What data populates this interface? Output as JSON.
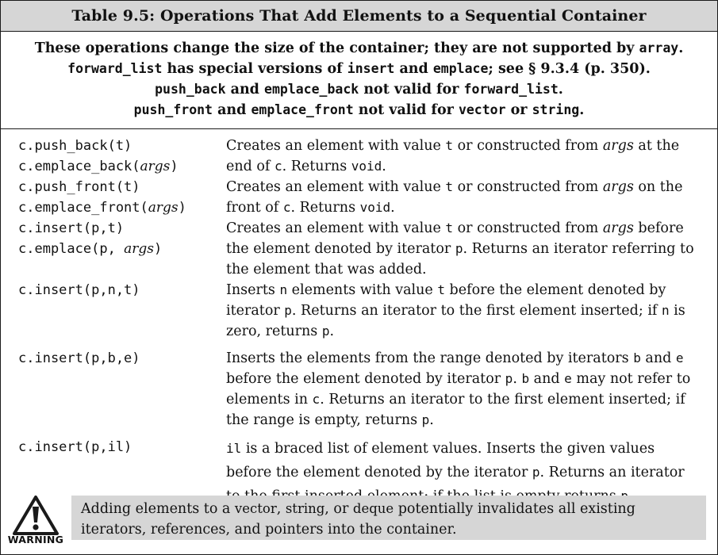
{
  "title": "Table 9.5: Operations That Add Elements to a Sequential Container",
  "notes": {
    "l1_a": "These operations change the size of the container; they are not supported by",
    "l1_b": "array",
    "l1_c": ".",
    "l2_a": "forward_list",
    "l2_b": " has special versions of ",
    "l2_c": "insert",
    "l2_d": " and ",
    "l2_e": "emplace",
    "l2_f": "; see § 9.3.4 (p. 350).",
    "l3_a": "push_back",
    "l3_b": " and ",
    "l3_c": "emplace_back",
    "l3_d": " not valid for ",
    "l3_e": "forward_list",
    "l3_f": ".",
    "l4_a": "push_front",
    "l4_b": " and ",
    "l4_c": "emplace_front",
    "l4_d": " not valid for ",
    "l4_e": "vector",
    "l4_f": " or ",
    "l4_g": "string",
    "l4_h": "."
  },
  "rows": [
    {
      "op1": "c.push_back(t)",
      "op2a": "c.emplace_back(",
      "op2b": "args",
      "op2c": ")",
      "d": [
        "Creates an element with value ",
        "t",
        " or constructed from ",
        "args",
        " at the end of ",
        "c",
        ". Returns ",
        "void",
        "."
      ]
    },
    {
      "op1": "c.push_front(t)",
      "op2a": "c.emplace_front(",
      "op2b": "args",
      "op2c": ")",
      "d": [
        "Creates an element with value ",
        "t",
        " or constructed from ",
        "args",
        " on the front of ",
        "c",
        ". Returns ",
        "void",
        "."
      ]
    },
    {
      "op1": "c.insert(p,t)",
      "op2a": "c.emplace(p, ",
      "op2b": "args",
      "op2c": ")",
      "d": [
        "Creates an element with value ",
        "t",
        " or constructed from ",
        "args",
        " before the element denoted by iterator ",
        "p",
        ". Returns an iterator referring to the element that was added."
      ]
    },
    {
      "op1": "c.insert(p,n,t)",
      "d": [
        "Inserts ",
        "n",
        " elements with value ",
        "t",
        " before the element denoted by iterator ",
        "p",
        ". Returns an iterator to the first element inserted; if ",
        "n",
        " is zero, returns ",
        "p",
        "."
      ]
    },
    {
      "op1": "c.insert(p,b,e)",
      "d": [
        "Inserts the elements from the range denoted by iterators ",
        "b",
        " and ",
        "e",
        " before the element denoted by iterator ",
        "p",
        ". ",
        "b",
        " and ",
        "e",
        " may not refer to elements in ",
        "c",
        ". Returns an iterator to the first element inserted; if the range is empty, returns ",
        "p",
        "."
      ]
    },
    {
      "op1": "c.insert(p,il)",
      "d": [
        "il",
        " is a braced list of element values. Inserts the given values before the element denoted by the iterator ",
        "p",
        ". Returns an iterator to the first inserted element; if the list is empty returns ",
        "p",
        "."
      ]
    }
  ],
  "warning": {
    "label": "WARNING",
    "t": [
      "Adding elements to a ",
      "vector",
      ", ",
      "string",
      ", or ",
      "deque",
      " potentially invalidates all existing iterators, references, and pointers into the container."
    ]
  }
}
